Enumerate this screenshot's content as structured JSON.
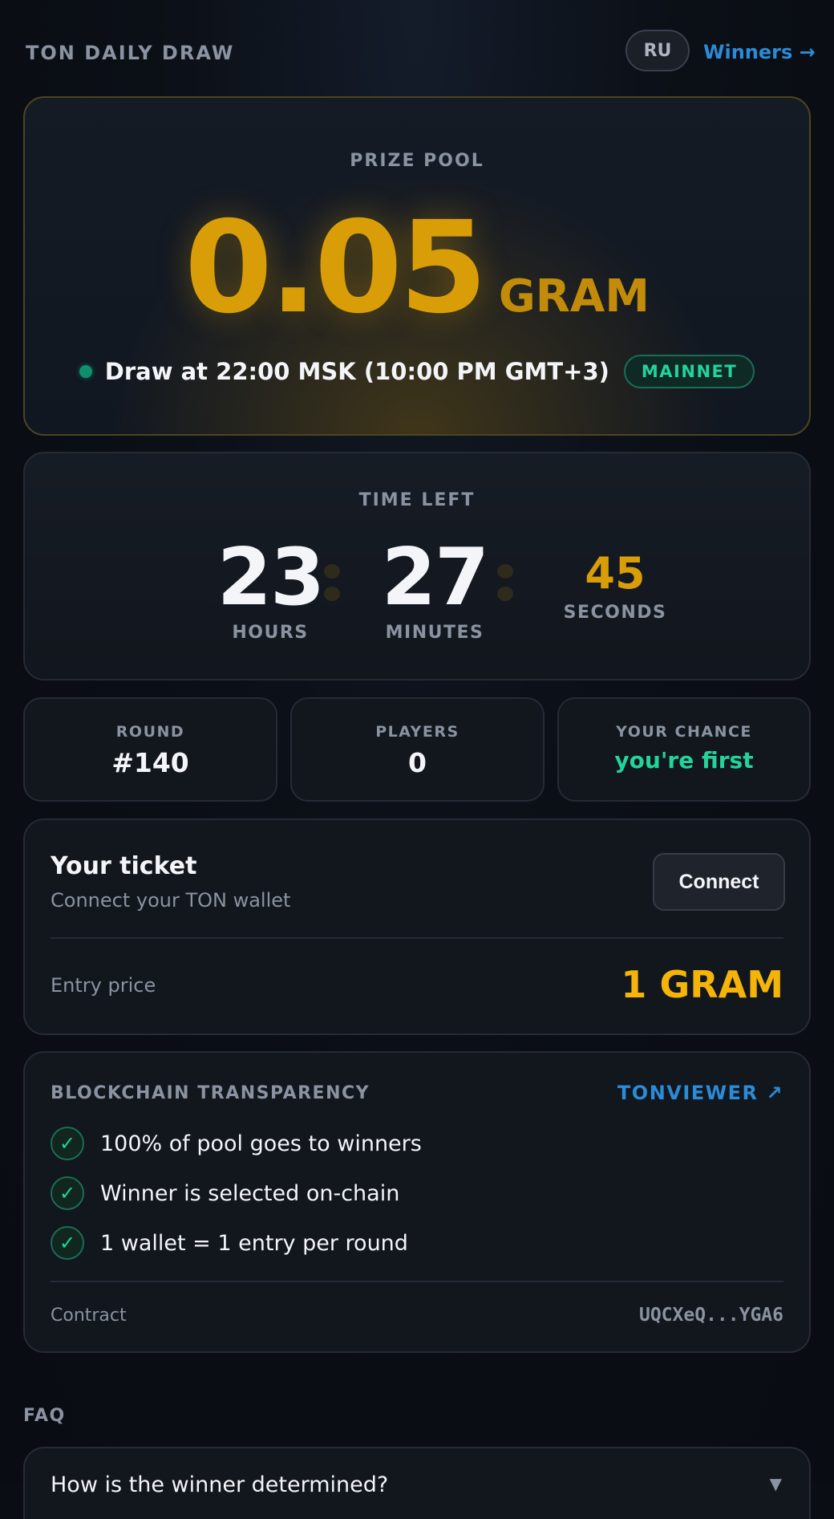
{
  "header": {
    "brand": "TON DAILY DRAW",
    "lang_button": "RU",
    "winners_link": "Winners →"
  },
  "prize": {
    "label": "PRIZE POOL",
    "amount": "0.05",
    "unit": "GRAM",
    "draw_time": "Draw at 22:00 MSK (10:00 PM GMT+3)",
    "network_badge": "MAINNET"
  },
  "timer": {
    "label": "TIME LEFT",
    "hours": "23",
    "hours_label": "HOURS",
    "minutes": "27",
    "minutes_label": "MINUTES",
    "seconds": "45",
    "seconds_label": "SECONDS"
  },
  "stats": {
    "round_label": "ROUND",
    "round_value": "#140",
    "players_label": "PLAYERS",
    "players_value": "0",
    "chance_label": "YOUR CHANCE",
    "chance_value": "you're first"
  },
  "ticket": {
    "title": "Your ticket",
    "subtitle": "Connect your TON wallet",
    "connect_button": "Connect",
    "entry_label": "Entry price",
    "entry_value": "1 GRAM"
  },
  "transparency": {
    "title": "BLOCKCHAIN TRANSPARENCY",
    "link": "TONVIEWER ↗",
    "items": [
      "100% of pool goes to winners",
      "Winner is selected on-chain",
      "1 wallet = 1 entry per round"
    ],
    "contract_label": "Contract",
    "contract_value": "UQCXeQ...YGA6"
  },
  "faq": {
    "title": "FAQ",
    "items": [
      {
        "question": "How is the winner determined?"
      }
    ]
  },
  "colors": {
    "accent_gold": "#d99d07",
    "accent_green": "#22d39a",
    "link_blue": "#2a8bd8",
    "background": "#0b0f16"
  }
}
